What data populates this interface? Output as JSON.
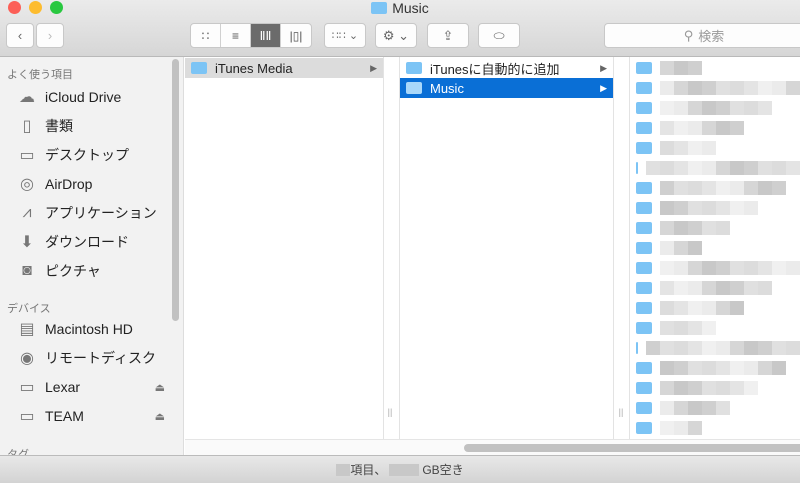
{
  "window": {
    "title": "Music"
  },
  "toolbar": {
    "search_placeholder": "検索"
  },
  "sidebar": {
    "favorites_header": "よく使う項目",
    "favorites": [
      {
        "label": "iCloud Drive",
        "icon": "cloud-icon"
      },
      {
        "label": "書類",
        "icon": "documents-icon"
      },
      {
        "label": "デスクトップ",
        "icon": "desktop-icon"
      },
      {
        "label": "AirDrop",
        "icon": "airdrop-icon"
      },
      {
        "label": "アプリケーション",
        "icon": "applications-icon"
      },
      {
        "label": "ダウンロード",
        "icon": "download-icon"
      },
      {
        "label": "ピクチャ",
        "icon": "camera-icon"
      }
    ],
    "devices_header": "デバイス",
    "devices": [
      {
        "label": "Macintosh HD",
        "icon": "hard-disk-icon"
      },
      {
        "label": "リモートディスク",
        "icon": "disc-icon"
      },
      {
        "label": "Lexar",
        "icon": "drive-icon",
        "eject": true
      },
      {
        "label": "TEAM",
        "icon": "drive-icon",
        "eject": true
      }
    ],
    "tags_header": "タグ"
  },
  "columns": [
    {
      "items": [
        {
          "label": "iTunes Media",
          "selected": "inactive"
        }
      ]
    },
    {
      "items": [
        {
          "label": "iTunesに自動的に追加"
        },
        {
          "label": "Music",
          "selected": "active"
        }
      ]
    }
  ],
  "column3_redacted_folder_count": 19,
  "status": {
    "items_suffix": "項目、",
    "free_suffix": "GB空き"
  },
  "colors": {
    "selection": "#0a6fd6",
    "folder": "#7cc4f5"
  }
}
